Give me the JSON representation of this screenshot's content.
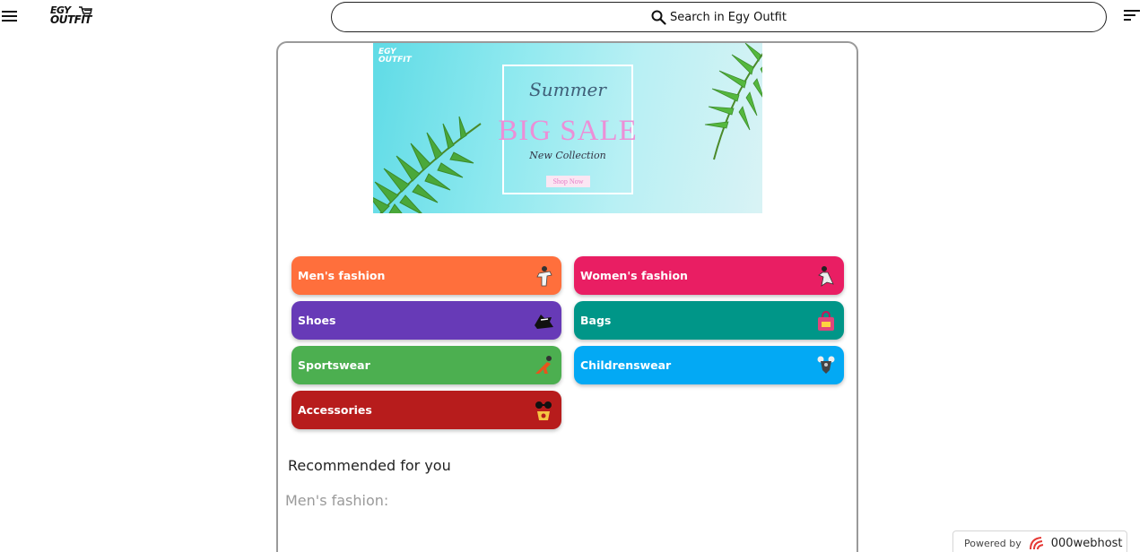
{
  "header": {
    "logo_line1": "EGY",
    "logo_line2": "OUTFIT",
    "search_placeholder": "Search in Egy Outfit"
  },
  "banner": {
    "logo_line1": "EGY",
    "logo_line2": "OUTFIT",
    "summer": "Summer",
    "sale": "BIG SALE",
    "collection": "New Collection",
    "shop_now": "Shop Now"
  },
  "categories": [
    {
      "label": "Men's fashion",
      "color": "#ff6f3c",
      "icon": "man-shirt-icon"
    },
    {
      "label": "Women's fashion",
      "color": "#e91e63",
      "icon": "woman-dress-icon"
    },
    {
      "label": "Shoes",
      "color": "#673ab7",
      "icon": "shoe-icon"
    },
    {
      "label": "Bags",
      "color": "#009688",
      "icon": "shopping-bag-icon"
    },
    {
      "label": "Sportswear",
      "color": "#4caf50",
      "icon": "sports-icon"
    },
    {
      "label": "Childrenswear",
      "color": "#03a9f4",
      "icon": "child-outfit-icon"
    },
    {
      "label": "Accessories",
      "color": "#b71c1c",
      "icon": "sunglasses-icon"
    }
  ],
  "recommended": {
    "title": "Recommended for you",
    "subtitle": "Men's fashion:"
  },
  "footer": {
    "powered_by": "Powered by",
    "brand": "000webhost"
  }
}
